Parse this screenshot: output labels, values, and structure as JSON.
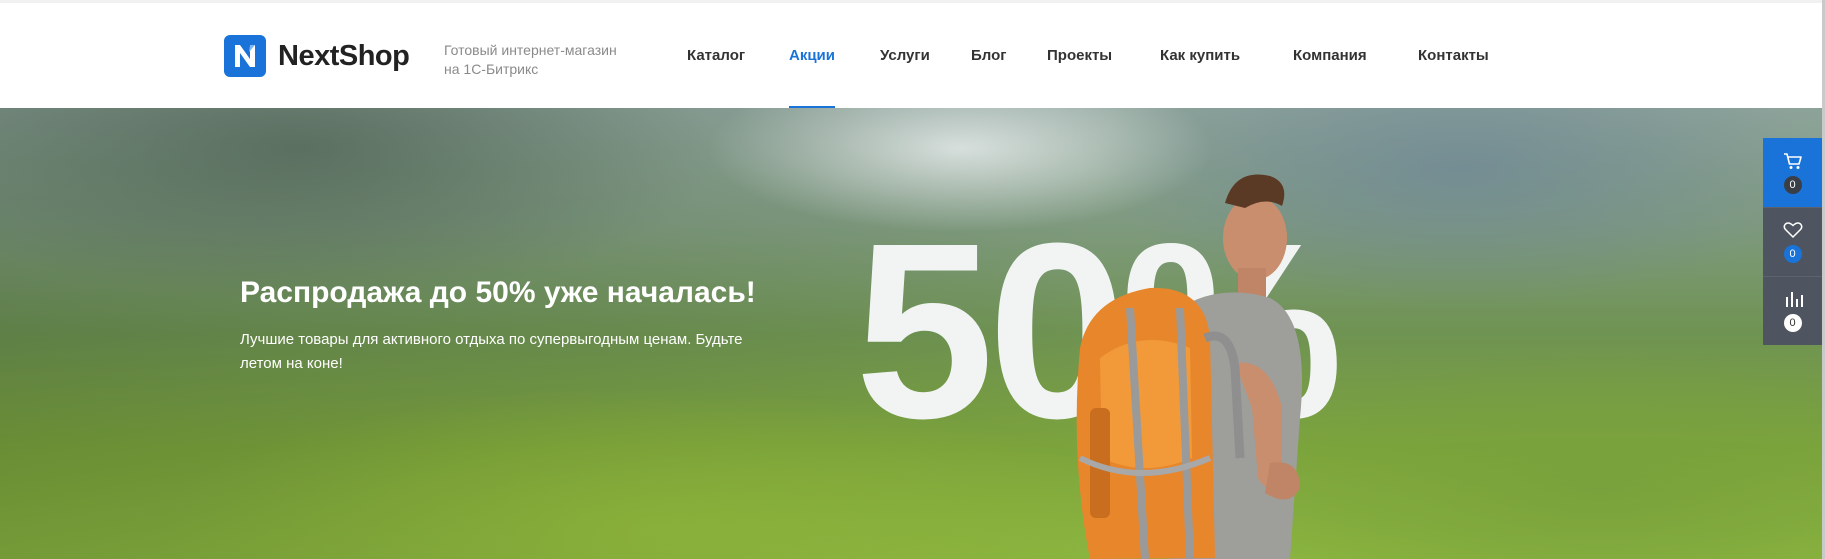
{
  "header": {
    "logo_text": "NextShop",
    "tagline": "Готовый интернет-магазин на 1С-Битрикс",
    "nav": [
      {
        "label": "Каталог",
        "active": false
      },
      {
        "label": "Акции",
        "active": true
      },
      {
        "label": "Услуги",
        "active": false
      },
      {
        "label": "Блог",
        "active": false
      },
      {
        "label": "Проекты",
        "active": false
      },
      {
        "label": "Как купить",
        "active": false
      },
      {
        "label": "Компания",
        "active": false
      },
      {
        "label": "Контакты",
        "active": false
      }
    ]
  },
  "hero": {
    "title": "Распродажа до 50% уже началась!",
    "description": "Лучшие товары для активного отдыха по супервыгодным ценам. Будьте летом на коне!",
    "big_text": "50%"
  },
  "side_panel": {
    "cart": {
      "icon": "cart-icon",
      "count": "0"
    },
    "favorites": {
      "icon": "heart-icon",
      "count": "0"
    },
    "compare": {
      "icon": "bar-chart-icon",
      "count": "0"
    }
  },
  "colors": {
    "accent": "#1a73d9",
    "nav_text": "#333333",
    "side_dark": "#4f5560"
  }
}
